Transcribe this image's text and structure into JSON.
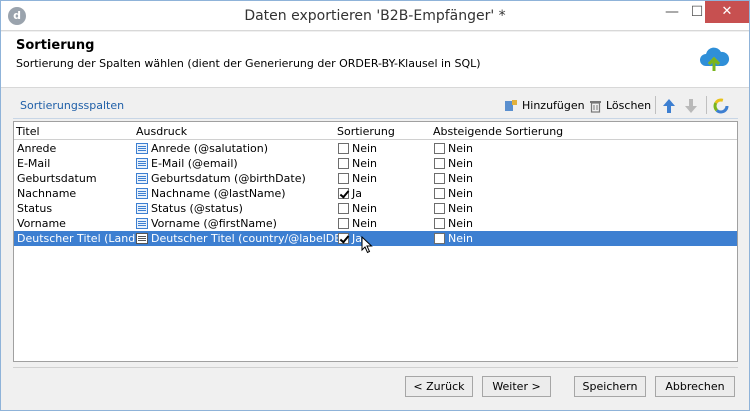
{
  "window": {
    "title": "Daten exportieren 'B2B-Empfänger' *",
    "app_icon_letter": "d",
    "minimize_glyph": "—",
    "maximize_glyph": "☐",
    "close_glyph": "✕"
  },
  "header": {
    "title": "Sortierung",
    "description": "Sortierung der Spalten wählen (dient der Generierung der ORDER-BY-Klausel in SQL)",
    "icon": "cloud-upload-icon"
  },
  "section": {
    "label": "Sortierungsspalten",
    "add_label": "Hinzufügen",
    "delete_label": "Löschen"
  },
  "table": {
    "columns": [
      "Titel",
      "Ausdruck",
      "Sortierung",
      "Absteigende Sortierung"
    ],
    "rows": [
      {
        "title": "Anrede",
        "expression": "Anrede (@salutation)",
        "sort": "Nein",
        "sort_checked": false,
        "desc": "Nein",
        "desc_checked": false
      },
      {
        "title": "E-Mail",
        "expression": "E-Mail (@email)",
        "sort": "Nein",
        "sort_checked": false,
        "desc": "Nein",
        "desc_checked": false
      },
      {
        "title": "Geburtsdatum",
        "expression": "Geburtsdatum (@birthDate)",
        "sort": "Nein",
        "sort_checked": false,
        "desc": "Nein",
        "desc_checked": false
      },
      {
        "title": "Nachname",
        "expression": "Nachname (@lastName)",
        "sort": "Ja",
        "sort_checked": true,
        "desc": "Nein",
        "desc_checked": false
      },
      {
        "title": "Status",
        "expression": "Status (@status)",
        "sort": "Nein",
        "sort_checked": false,
        "desc": "Nein",
        "desc_checked": false
      },
      {
        "title": "Vorname",
        "expression": "Vorname (@firstName)",
        "sort": "Nein",
        "sort_checked": false,
        "desc": "Nein",
        "desc_checked": false
      },
      {
        "title": "Deutscher Titel (Land)",
        "expression": "Deutscher Titel (country/@labelDE)",
        "sort": "Ja",
        "sort_checked": true,
        "desc": "Nein",
        "desc_checked": false,
        "selected": true
      }
    ]
  },
  "footer": {
    "back_label": "< Zurück",
    "next_label": "Weiter >",
    "save_label": "Speichern",
    "cancel_label": "Abbrechen"
  },
  "colors": {
    "selection": "#3d7fd1",
    "accent_blue": "#1f5fa8",
    "close_red": "#c75050"
  }
}
